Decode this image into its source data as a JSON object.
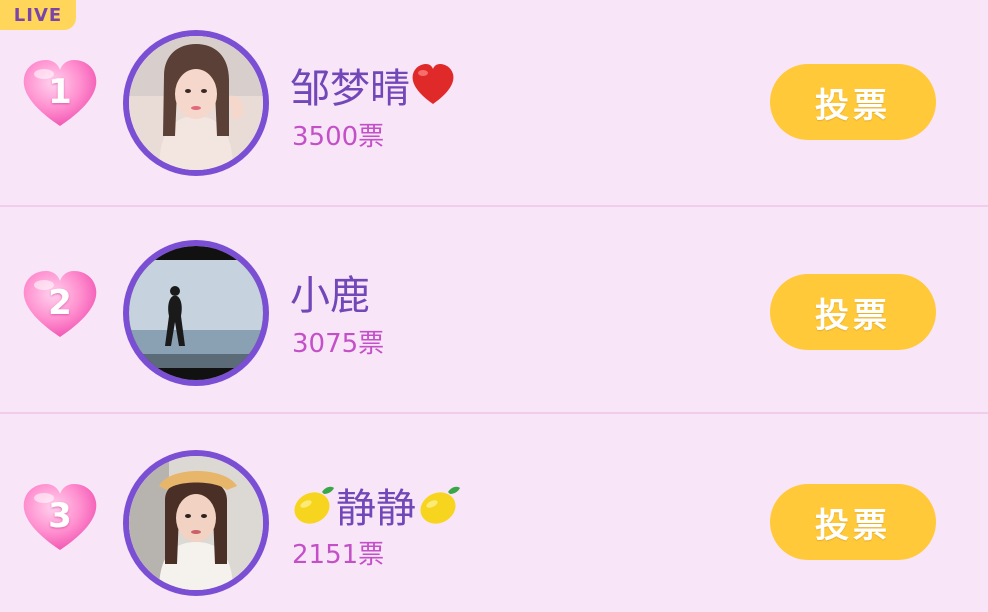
{
  "badge": {
    "label": "LIVE"
  },
  "entries": [
    {
      "rank": "1",
      "name": "邹梦晴",
      "suffix_emoji": "red-heart",
      "votes": "3500票",
      "button_label": "投票"
    },
    {
      "rank": "2",
      "name": "小鹿",
      "votes": "3075票",
      "button_label": "投票"
    },
    {
      "rank": "3",
      "name": "静静",
      "prefix_emoji": "lemon",
      "suffix_emoji": "lemon",
      "votes": "2151票",
      "button_label": "投票"
    }
  ],
  "colors": {
    "background": "#f8e5f8",
    "name_text": "#7247b8",
    "votes_text": "#c450c8",
    "button": "#ffc93a",
    "avatar_ring": "#7b4fd3",
    "badge": "#ffd65a"
  }
}
